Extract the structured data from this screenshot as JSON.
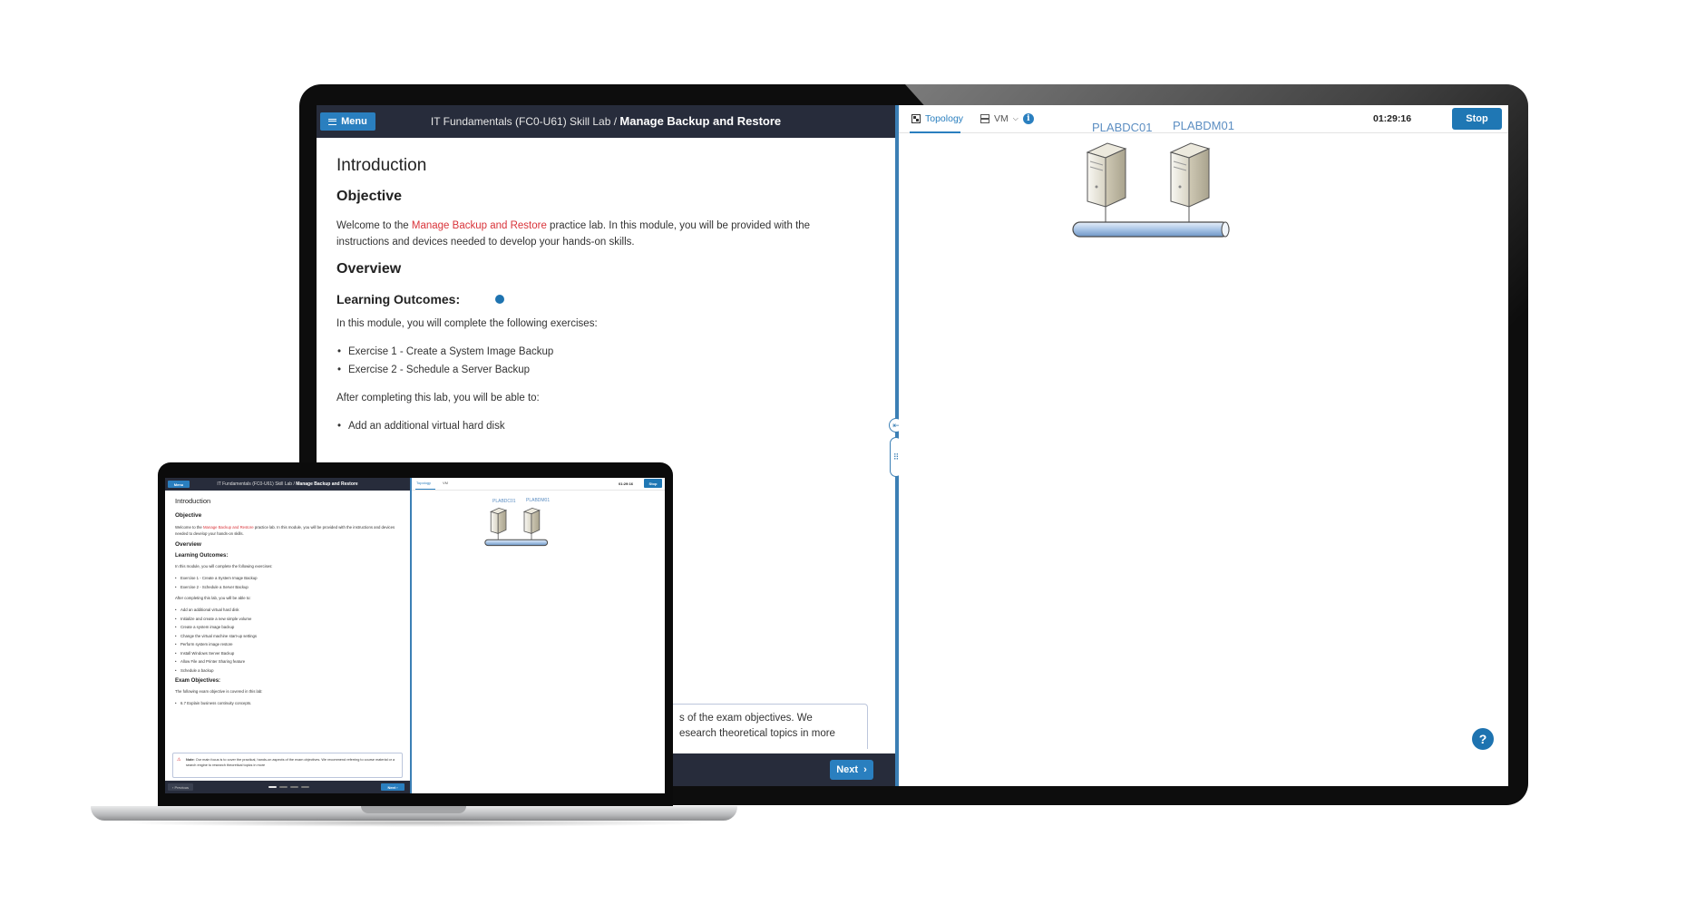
{
  "header": {
    "menu_label": "Menu",
    "course": "IT Fundamentals (FC0-U61) Skill Lab /",
    "module": "Manage Backup and Restore"
  },
  "content": {
    "intro_heading": "Introduction",
    "objective_heading": "Objective",
    "objective_pre": "Welcome to the ",
    "objective_link": "Manage Backup and Restore",
    "objective_post": " practice lab. In this module, you will be provided with the instructions and devices needed to develop your hands-on skills.",
    "overview_heading": "Overview",
    "outcomes_heading": "Learning Outcomes:",
    "outcomes_intro": "In this module, you will complete the following exercises:",
    "exercises": [
      "Exercise 1 - Create a System Image Backup",
      "Exercise 2 - Schedule a Server Backup"
    ],
    "after_intro": "After completing this lab, you will be able to:",
    "skills": [
      "Add an additional virtual hard disk",
      "Initialize and create a new simple volume",
      "Create a system image backup",
      "Change the virtual machine start-up settings",
      "Perform system image restore",
      "Install Windows Server Backup",
      "Allow File and Printer Sharing feature",
      "Schedule a backup"
    ],
    "exam_heading": "Exam Objectives:",
    "exam_intro": "The following exam objective is covered in this lab:",
    "exam_items": [
      "6.7 Explain business continuity concepts."
    ],
    "note_label": "Note:",
    "note_text": "Our main focus is to cover the practical, hands-on aspects of the exam objectives. We recommend referring to course material or a search engine to research theoretical topics in more",
    "note_fragment_line1": "s of the exam objectives. We",
    "note_fragment_line2": "esearch theoretical topics in more"
  },
  "footer": {
    "previous_label": "Previous",
    "next_label": "Next"
  },
  "topology_panel": {
    "tab_topology": "Topology",
    "tab_vm": "VM",
    "timer": "01:29:16",
    "stop_label": "Stop",
    "help_label": "?",
    "servers": [
      "PLABDC01",
      "PLABDM01"
    ]
  },
  "colors": {
    "header_bg": "#272c3b",
    "accent_blue": "#2a7fbf",
    "link_red": "#d9343a",
    "server_label": "#5c8ec2"
  }
}
